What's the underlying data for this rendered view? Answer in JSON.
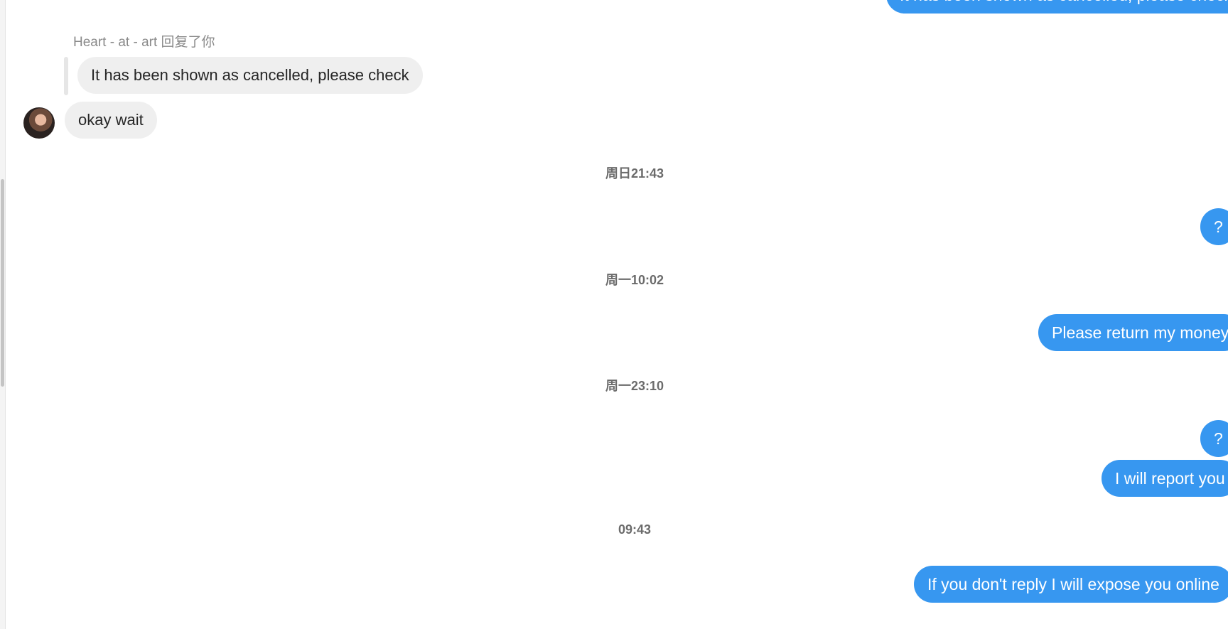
{
  "header": {
    "partial_message": "It has been shown as cancelled, please check"
  },
  "reply": {
    "label": "Heart - at - art 回复了你",
    "quoted_text": "It has been shown as cancelled, please check"
  },
  "incoming": {
    "text": "okay wait"
  },
  "timestamps": [
    "周日21:43",
    "周一10:02",
    "周一23:10",
    "09:43"
  ],
  "outgoing": [
    "?",
    "Please return my money",
    "?",
    "I will report you",
    "If you don't reply I will expose you online"
  ],
  "colors": {
    "outgoing_bubble": "#3797f0",
    "incoming_bubble": "#efefef"
  }
}
